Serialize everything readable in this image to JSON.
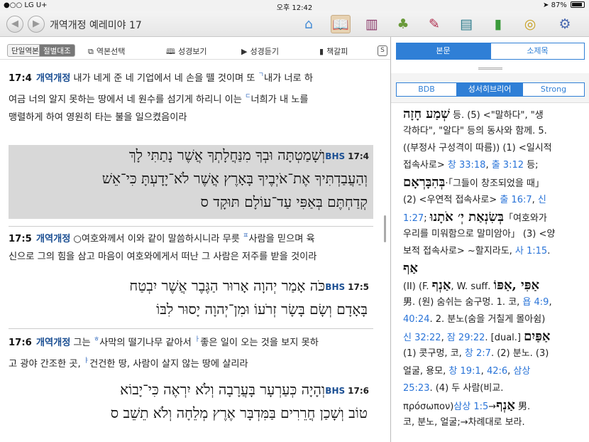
{
  "status": {
    "carrier": "●○○ LG U+",
    "time": "오후 12:42",
    "battery": "87%",
    "battery_level": 0.87
  },
  "nav": {
    "back_glyph": "◀",
    "forward_glyph": "▶",
    "title": "개역개정 예레미야 17"
  },
  "toolbar_icons": [
    {
      "name": "home-icon",
      "glyph": "⌂",
      "color": "#4a8fd6"
    },
    {
      "name": "book-icon",
      "glyph": "📖",
      "color": "#b23a2a"
    },
    {
      "name": "library-icon",
      "glyph": "▥",
      "color": "#8a3a6a"
    },
    {
      "name": "tree-icon",
      "glyph": "♣",
      "color": "#6a9a3a"
    },
    {
      "name": "pen-icon",
      "glyph": "✎",
      "color": "#b03050"
    },
    {
      "name": "image-icon",
      "glyph": "▤",
      "color": "#2a7a8a"
    },
    {
      "name": "notebook-icon",
      "glyph": "▮",
      "color": "#3a9a3a"
    },
    {
      "name": "lifebuoy-icon",
      "glyph": "◎",
      "color": "#c8a020"
    },
    {
      "name": "settings-icon",
      "glyph": "⚙",
      "color": "#4a6ab0"
    }
  ],
  "left_toolbar": {
    "single": "단일역본",
    "parallel": "절별대조",
    "select_version": "역본선택",
    "view_bible": "성경보기",
    "listen_bible": "성경듣기",
    "bookmark": "책갈피",
    "s_label": "S"
  },
  "verses": [
    {
      "ref": "17:4",
      "version": "개역개정",
      "lines": [
        {
          "pre": "내가 네게 준 네 기업에서 네 손을 뗄 것이며 또 ",
          "fn": "ㄱ",
          "post": "내가 너로 하"
        },
        {
          "pre": "여금 너의 알지 못하는 땅에서 네 원수를 섬기게 하리니 이는 ",
          "fn": "ㄷ",
          "post": "너희가 내 노를"
        },
        {
          "pre": "맹렬하게 하여 영원히 타는 불을 일으켰음이라",
          "fn": "",
          "post": ""
        }
      ],
      "bhs_label": "BHS",
      "bhs_ref": "17:4",
      "hebrew": [
        "וְשָׁמַטְתָּה וּבְךָ מִנַּחֲלָתְךָ אֲשֶׁר נָתַתִּי לָךְ",
        "וְהַעֲבַדְתִּיךָ אֶת־אֹיְבֶיךָ בָּאָרֶץ אֲשֶׁר לֹא־יָדָעְתָּ כִּי־אֵשׁ",
        "קְדַחְתֶּם בְּאַפִּי עַד־עוֹלָם תּוּקָד ס"
      ]
    },
    {
      "ref": "17:5",
      "version": "개역개정",
      "lines": [
        {
          "pre": "○여호와께서 이와 같이 말씀하시니라 무릇 ",
          "fn": "ㅍ",
          "post": "사람을 믿으며 육"
        },
        {
          "pre": "신으로 그의 힘을 삼고 마음이 여호와에게서 떠난 그 사람은 저주를 받을 것이라",
          "fn": "",
          "post": ""
        }
      ],
      "bhs_label": "BHS",
      "bhs_ref": "17:5",
      "hebrew": [
        "כֹּה אָמַר יְהוָה אָרוּר הַגֶּבֶר אֲשֶׁר יִבְטַח",
        "בָּאָדָם וְשָׂם בָּשָׂר זְרֹעוֹ וּמִן־יְהוָה יָסוּר לִבּוֹ"
      ]
    },
    {
      "ref": "17:6",
      "version": "개역개정",
      "lines": [
        {
          "pre": "그는 ",
          "fn": "ㅎ",
          "post": "사막의 떨기나무 같아서 ",
          "fn2": "ㅏ",
          "post2": "좋은 일이 오는 것을 보지 못하"
        },
        {
          "pre": "고 광야 간조한 곳, ",
          "fn": "ㅑ",
          "post": "건건한 땅, 사람이 살지 않는 땅에 살리라"
        }
      ],
      "bhs_label": "BHS",
      "bhs_ref": "17:6",
      "hebrew": [
        "וְהָיָה כְּעַרְעָר בָּעֲרָבָה וְלֹא יִרְאֶה כִּי־יָבוֹא",
        "טוֹב וְשָׁכַן חֲרֵרִים בַּמִּדְבָּר אֶרֶץ מְלֵחָה וְלֹא תֵשֵׁב ס"
      ]
    }
  ],
  "right": {
    "tab_text": "본문",
    "tab_outline": "소제목",
    "lex_tabs": [
      "BDB",
      "성서히브리어",
      "Strong"
    ],
    "lines": [
      [
        {
          "t": "שְׁמַע חָזָה",
          "c": "h"
        },
        {
          "t": " 등. (5) <\"말하다\", \"생",
          "c": ""
        }
      ],
      [
        {
          "t": "각하다\", \"알다\" 등의 동사와 함께. 5.",
          "c": ""
        }
      ],
      [
        {
          "t": "((부정사 구성격이 따름)) (1) <일시적",
          "c": ""
        }
      ],
      [
        {
          "t": "접속사로> ",
          "c": ""
        },
        {
          "t": "창 33:18",
          "c": "l"
        },
        {
          "t": ", ",
          "c": ""
        },
        {
          "t": "출 3:12",
          "c": "l"
        },
        {
          "t": " 등;",
          "c": ""
        }
      ],
      [
        {
          "t": "בְּהִבָּרְאָם",
          "c": "h"
        },
        {
          "t": "·「그들이 창조되었을 때」",
          "c": ""
        }
      ],
      [
        {
          "t": "(2) <우연적 접속사로> ",
          "c": ""
        },
        {
          "t": "출 16:7",
          "c": "l"
        },
        {
          "t": ", ",
          "c": ""
        },
        {
          "t": "신",
          "c": "l"
        }
      ],
      [
        {
          "t": "1:27",
          "c": "l"
        },
        {
          "t": "; ",
          "c": ""
        },
        {
          "t": "בְּשִׂנְאַת יְ׳ אֹתָנוּ",
          "c": "h"
        },
        {
          "t": "「여호와가",
          "c": ""
        }
      ],
      [
        {
          "t": "우리를 미워함으로 말미암아」 (3) <양",
          "c": ""
        }
      ],
      [
        {
          "t": "보적 접속사로> ~할지라도, ",
          "c": ""
        },
        {
          "t": "사 1:15",
          "c": "l"
        },
        {
          "t": ".",
          "c": ""
        }
      ],
      [
        {
          "t": "אַף",
          "c": "h"
        }
      ],
      [
        {
          "t": "(II) (F. ",
          "c": ""
        },
        {
          "t": "אַנְף",
          "c": "h"
        },
        {
          "t": ", W. suff. ",
          "c": ""
        },
        {
          "t": "אַפִּי ,אַפּוֹ",
          "c": "h"
        }
      ],
      [
        {
          "t": "男. (원) 숨쉬는 숨구멍. 1. 코, ",
          "c": ""
        },
        {
          "t": "욥 4:9",
          "c": "l"
        },
        {
          "t": ",",
          "c": ""
        }
      ],
      [
        {
          "t": "40:24",
          "c": "l"
        },
        {
          "t": ". 2. 분노(숨을 거칠게 몰아쉼)",
          "c": ""
        }
      ],
      [
        {
          "t": "신 32:22",
          "c": "l"
        },
        {
          "t": ", ",
          "c": ""
        },
        {
          "t": "잠 29:22",
          "c": "l"
        },
        {
          "t": ". [dual.] ",
          "c": ""
        },
        {
          "t": "אַפַּיִם",
          "c": "h"
        }
      ],
      [
        {
          "t": "(1) 콧구멍, 코, ",
          "c": ""
        },
        {
          "t": "창 2:7",
          "c": "l"
        },
        {
          "t": ". (2) 분노. (3)",
          "c": ""
        }
      ],
      [
        {
          "t": "얼굴, 용모, ",
          "c": ""
        },
        {
          "t": "창 19:1",
          "c": "l"
        },
        {
          "t": ", ",
          "c": ""
        },
        {
          "t": "42:6",
          "c": "l"
        },
        {
          "t": ", ",
          "c": ""
        },
        {
          "t": "삼상",
          "c": "l"
        }
      ],
      [
        {
          "t": "25:23",
          "c": "l"
        },
        {
          "t": ". (4) 두 사람(비교.",
          "c": ""
        }
      ],
      [
        {
          "t": "πρόσωπον",
          "c": ""
        },
        {
          "t": ")",
          "c": ""
        },
        {
          "t": "삼상 1:5",
          "c": "l"
        },
        {
          "t": "→",
          "c": ""
        },
        {
          "t": "אַנְף",
          "c": "h"
        },
        {
          "t": " 男.",
          "c": ""
        }
      ],
      [
        {
          "t": "코, 분노, 얼굴;→차례대로 보라.",
          "c": ""
        }
      ]
    ]
  },
  "colors": {
    "accent": "#2f7fd6",
    "version": "#1b4f93",
    "link": "#2a74d8",
    "highlight": "#d8d8d8"
  }
}
